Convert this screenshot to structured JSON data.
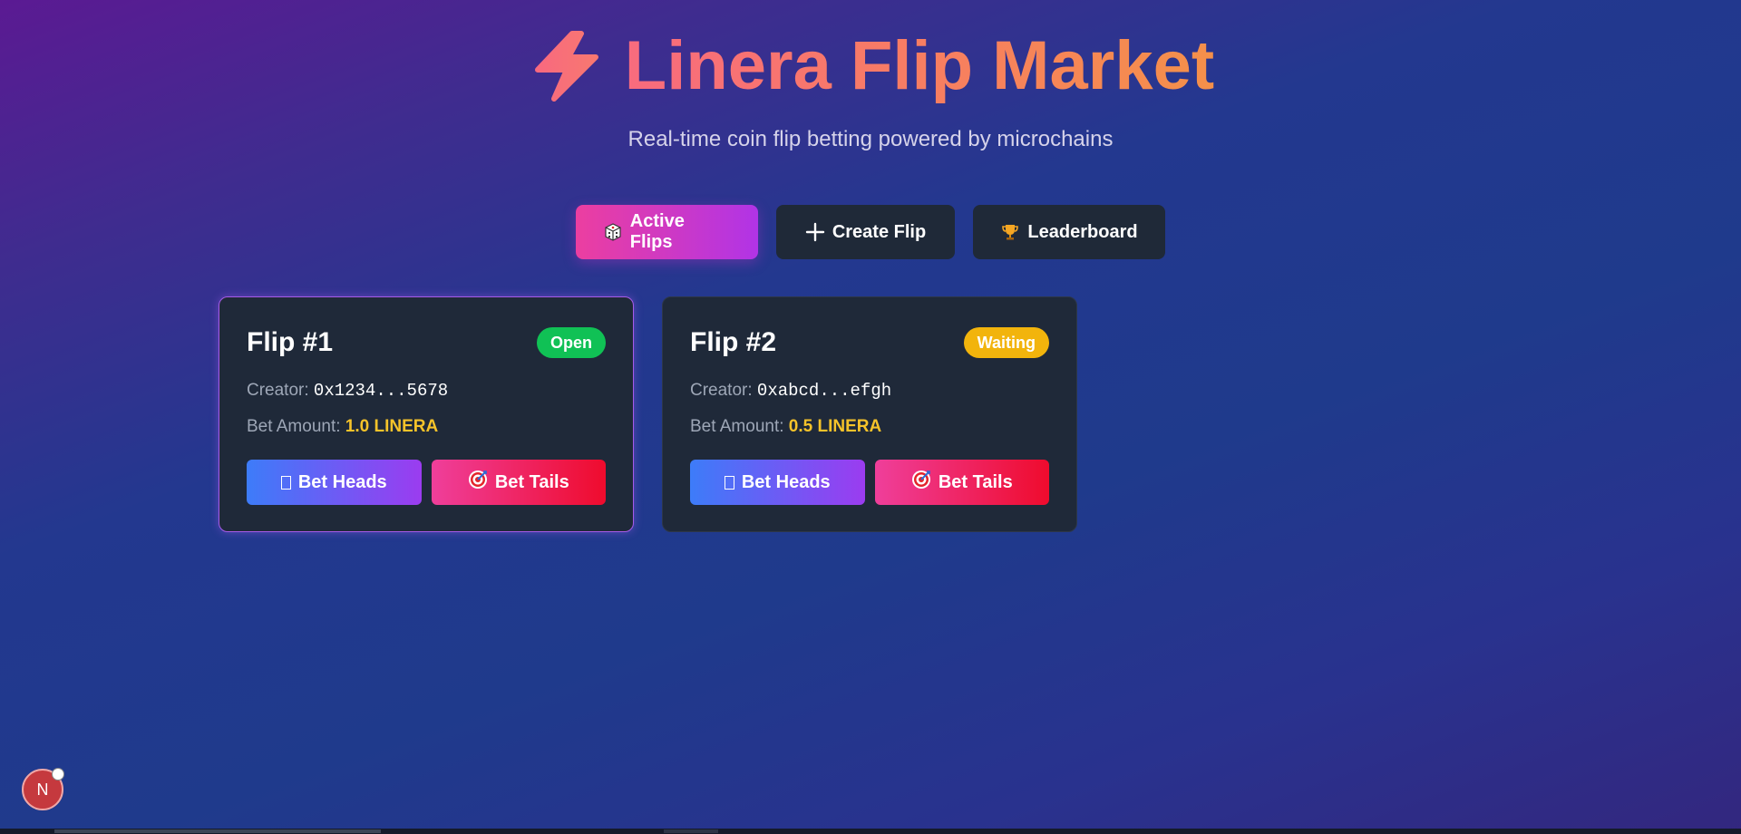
{
  "header": {
    "title": "Linera Flip Market",
    "subtitle": "Real-time coin flip betting powered by microchains",
    "title_icon": "lightning-bolt-icon"
  },
  "tabs": [
    {
      "label": "Active Flips",
      "icon": "dice-icon",
      "active": true
    },
    {
      "label": "Create Flip",
      "icon": "plus-icon",
      "active": false
    },
    {
      "label": "Leaderboard",
      "icon": "trophy-icon",
      "active": false
    }
  ],
  "flips": [
    {
      "title": "Flip #1",
      "status": "Open",
      "status_color": "#10c155",
      "creator_label": "Creator:",
      "creator": "0x1234...5678",
      "bet_label": "Bet Amount:",
      "amount": "1.0 LINERA",
      "heads_label": "Bet Heads",
      "tails_label": "Bet Tails"
    },
    {
      "title": "Flip #2",
      "status": "Waiting",
      "status_color": "#f2b40c",
      "creator_label": "Creator:",
      "creator": "0xabcd...efgh",
      "bet_label": "Bet Amount:",
      "amount": "0.5 LINERA",
      "heads_label": "Bet Heads",
      "tails_label": "Bet Tails"
    }
  ],
  "fab": {
    "label": "N"
  },
  "colors": {
    "accent_pink": "#ec3ea0",
    "accent_purple": "#b134e6",
    "card_bg": "#1f2939",
    "amount": "#f6c32a"
  }
}
